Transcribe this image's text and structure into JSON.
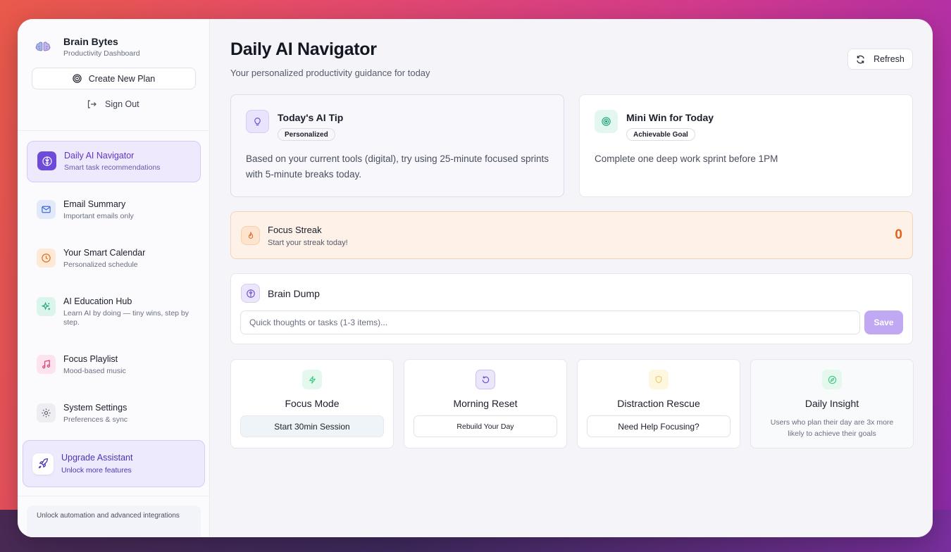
{
  "sidebar": {
    "brand_title": "Brain Bytes",
    "brand_subtitle": "Productivity Dashboard",
    "create_plan_label": "Create New Plan",
    "sign_out_label": "Sign Out",
    "items": [
      {
        "title": "Daily AI Navigator",
        "subtitle": "Smart task recommendations",
        "icon": "brain-icon",
        "active": true
      },
      {
        "title": "Email Summary",
        "subtitle": "Important emails only",
        "icon": "mail-icon"
      },
      {
        "title": "Your Smart Calendar",
        "subtitle": "Personalized schedule",
        "icon": "clock-icon"
      },
      {
        "title": "AI Education Hub",
        "subtitle": "Learn AI by doing — tiny wins, step by step.",
        "icon": "sparkle-icon"
      },
      {
        "title": "Focus Playlist",
        "subtitle": "Mood-based music",
        "icon": "music-icon"
      },
      {
        "title": "System Settings",
        "subtitle": "Preferences & sync",
        "icon": "gear-icon"
      }
    ],
    "upgrade": {
      "title": "Upgrade Assistant",
      "subtitle": "Unlock more features"
    },
    "promo_text": "Unlock automation and advanced integrations"
  },
  "header": {
    "title": "Daily AI Navigator",
    "subtitle": "Your personalized productivity guidance for today",
    "refresh_label": "Refresh"
  },
  "tip": {
    "title": "Today's AI Tip",
    "badge": "Personalized",
    "body": "Based on your current tools (digital), try using 25-minute focused sprints with 5-minute breaks today."
  },
  "mini_win": {
    "title": "Mini Win for Today",
    "badge": "Achievable Goal",
    "body": "Complete one deep work sprint before 1PM"
  },
  "streak": {
    "title": "Focus Streak",
    "subtitle": "Start your streak today!",
    "count": "0"
  },
  "brain_dump": {
    "title": "Brain Dump",
    "placeholder": "Quick thoughts or tasks (1-3 items)...",
    "save_label": "Save"
  },
  "actions": [
    {
      "title": "Focus Mode",
      "button": "Start 30min Session",
      "icon": "lightning-icon"
    },
    {
      "title": "Morning Reset",
      "button": "Rebuild Your Day",
      "icon": "rotate-icon"
    },
    {
      "title": "Distraction Rescue",
      "button": "Need Help Focusing?",
      "icon": "shield-icon"
    },
    {
      "title": "Daily Insight",
      "text": "Users who plan their day are 3x more likely to achieve their goals",
      "icon": "compass-icon"
    }
  ],
  "colors": {
    "accent": "#6b46d9",
    "streak_orange": "#e2611d",
    "save_button": "#c0a8f3"
  }
}
